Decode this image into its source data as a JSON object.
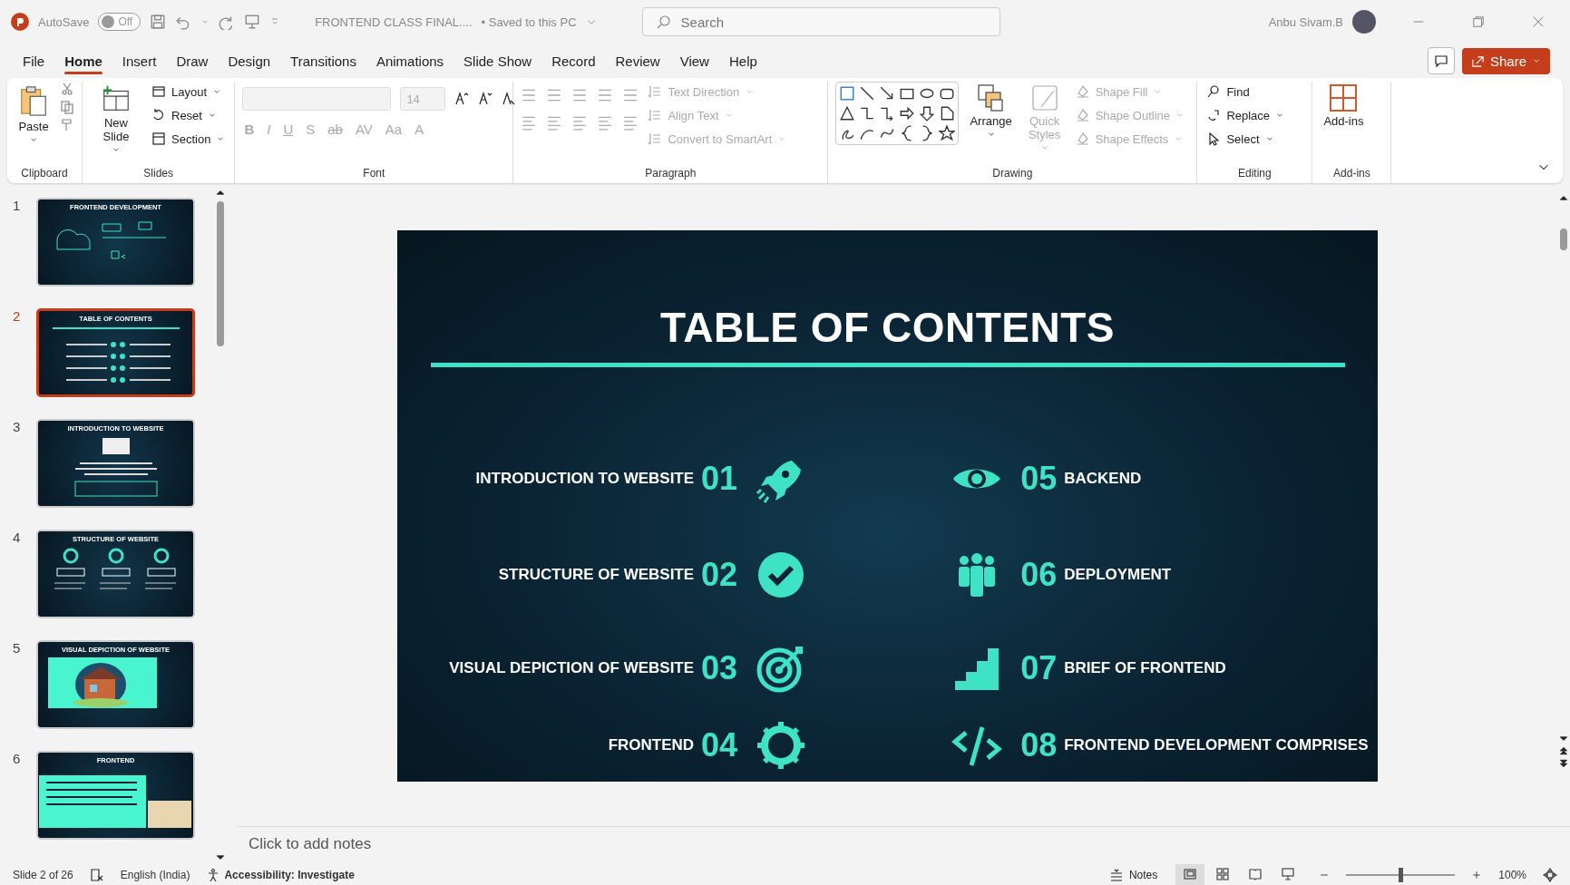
{
  "title_bar": {
    "autosave_label": "AutoSave",
    "autosave": {
      "on": false,
      "label": "Off"
    },
    "file_name": "FRONTEND CLASS FINAL....",
    "save_status": "• Saved to this PC",
    "search": {
      "placeholder": "Search"
    },
    "user_name": "Anbu Sivam.B"
  },
  "menu": {
    "tabs": [
      {
        "label": "File",
        "selected": false
      },
      {
        "label": "Home",
        "selected": true
      },
      {
        "label": "Insert",
        "selected": false
      },
      {
        "label": "Draw",
        "selected": false
      },
      {
        "label": "Design",
        "selected": false
      },
      {
        "label": "Transitions",
        "selected": false
      },
      {
        "label": "Animations",
        "selected": false
      },
      {
        "label": "Slide Show",
        "selected": false
      },
      {
        "label": "Record",
        "selected": false
      },
      {
        "label": "Review",
        "selected": false
      },
      {
        "label": "View",
        "selected": false
      },
      {
        "label": "Help",
        "selected": false
      }
    ],
    "share": "Share"
  },
  "ribbon": {
    "clipboard": {
      "label": "Clipboard",
      "paste": "Paste"
    },
    "slides": {
      "label": "Slides",
      "new_slide": "New Slide",
      "commands": [
        {
          "label": "Layout",
          "disabled": false
        },
        {
          "label": "Reset",
          "disabled": false
        },
        {
          "label": "Section",
          "disabled": false
        }
      ]
    },
    "font": {
      "label": "Font",
      "size": "14",
      "disabled": true,
      "format_buttons": [
        "B",
        "I",
        "U",
        "S",
        "ab",
        "AV",
        "Aa",
        "A"
      ]
    },
    "paragraph": {
      "label": "Paragraph",
      "commands": [
        {
          "label": "Text Direction",
          "disabled": true
        },
        {
          "label": "Align Text",
          "disabled": true
        },
        {
          "label": "Convert to SmartArt",
          "disabled": true
        }
      ]
    },
    "drawing": {
      "label": "Drawing",
      "arrange": {
        "label": "Arrange",
        "disabled": false
      },
      "quick_styles": {
        "label": "Quick Styles",
        "disabled": true
      },
      "commands": [
        {
          "label": "Shape Fill",
          "disabled": true
        },
        {
          "label": "Shape Outline",
          "disabled": true
        },
        {
          "label": "Shape Effects",
          "disabled": true
        }
      ]
    },
    "editing": {
      "label": "Editing",
      "commands": [
        {
          "label": "Find",
          "disabled": false
        },
        {
          "label": "Replace",
          "disabled": false
        },
        {
          "label": "Select",
          "disabled": false
        }
      ]
    },
    "addins": {
      "label": "Add-ins",
      "button": "Add-ins"
    }
  },
  "slide_thumbnails": [
    {
      "number": "1",
      "title": "FRONTEND DEVELOPMENT",
      "selected": false,
      "kind": "cover"
    },
    {
      "number": "2",
      "title": "TABLE OF CONTENTS",
      "selected": true,
      "kind": "contents"
    },
    {
      "number": "3",
      "title": "INTRODUCTION TO WEBSITE",
      "selected": false,
      "kind": "text"
    },
    {
      "number": "4",
      "title": "STRUCTURE OF WEBSITE",
      "selected": false,
      "kind": "columns"
    },
    {
      "number": "5",
      "title": "VISUAL DEPICTION OF WEBSITE",
      "selected": false,
      "kind": "picture"
    },
    {
      "number": "6",
      "title": "FRONTEND",
      "selected": false,
      "kind": "panel"
    }
  ],
  "slide": {
    "title": "TABLE OF CONTENTS",
    "items": [
      {
        "number": "01",
        "label": "INTRODUCTION TO WEBSITE"
      },
      {
        "number": "05",
        "label": "BACKEND"
      },
      {
        "number": "02",
        "label": "STRUCTURE OF WEBSITE"
      },
      {
        "number": "06",
        "label": "DEPLOYMENT"
      },
      {
        "number": "03",
        "label": "VISUAL DEPICTION OF WEBSITE"
      },
      {
        "number": "07",
        "label": "BRIEF OF FRONTEND"
      },
      {
        "number": "04",
        "label": "FRONTEND"
      },
      {
        "number": "08",
        "label": "FRONTEND DEVELOPMENT COMPRISES"
      }
    ]
  },
  "notes": {
    "placeholder": "Click to add notes"
  },
  "status_bar": {
    "slide_position": "Slide 2 of 26",
    "language": "English (India)",
    "accessibility": "Accessibility: Investigate",
    "notes": "Notes",
    "views": [
      {
        "selected": true
      },
      {
        "selected": false
      },
      {
        "selected": false
      },
      {
        "selected": false
      }
    ],
    "zoom": {
      "level": 0.5,
      "reading": "100%"
    }
  }
}
